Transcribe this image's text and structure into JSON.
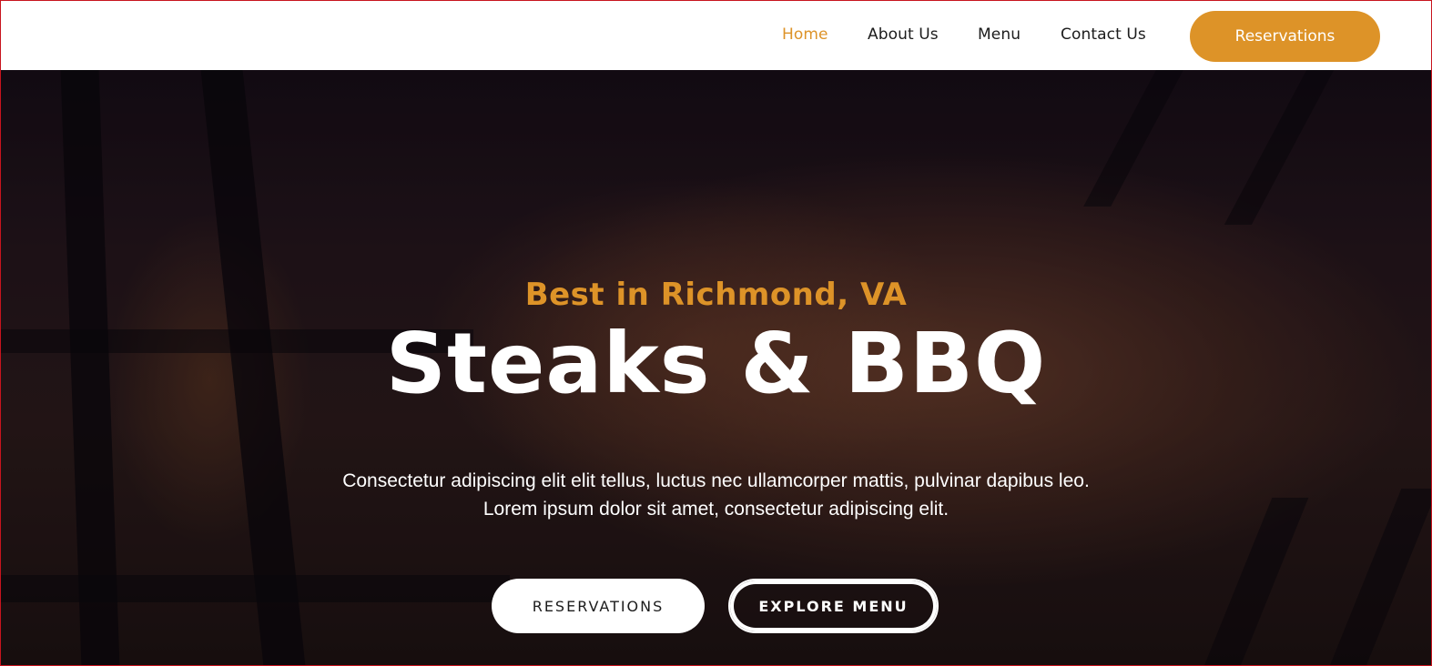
{
  "nav": {
    "items": [
      {
        "label": "Home",
        "active": true
      },
      {
        "label": "About Us",
        "active": false
      },
      {
        "label": "Menu",
        "active": false
      },
      {
        "label": "Contact Us",
        "active": false
      }
    ],
    "reserve_label": "Reservations"
  },
  "hero": {
    "eyebrow": "Best in Richmond, VA",
    "title": "Steaks & BBQ",
    "description_lines": [
      "Consectetur adipiscing elit elit tellus, luctus nec ullamcorper mattis, pulvinar dapibus leo.",
      "Lorem ipsum dolor sit amet, consectetur adipiscing elit."
    ],
    "primary_button": "RESERVATIONS",
    "secondary_button": "EXPLORE MENU"
  },
  "colors": {
    "accent": "#dd9328",
    "header_bg": "#ffffff",
    "text_dark": "#1c1c1c",
    "text_light": "#ffffff"
  }
}
